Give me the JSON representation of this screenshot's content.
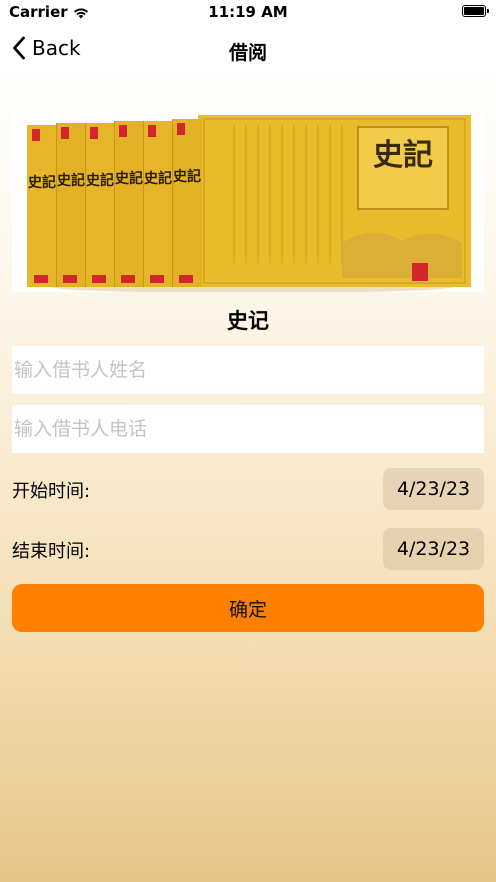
{
  "status_bar": {
    "carrier": "Carrier",
    "time": "11:19 AM"
  },
  "nav": {
    "back_label": "Back",
    "title": "借阅"
  },
  "book": {
    "title": "史记",
    "cover_spine_text": "史記",
    "cover_front_text": "史記"
  },
  "form": {
    "name_placeholder": "输入借书人姓名",
    "name_value": "",
    "phone_placeholder": "输入借书人电话",
    "phone_value": "",
    "start_label": "开始时间:",
    "start_date": "4/23/23",
    "end_label": "结束时间:",
    "end_date": "4/23/23",
    "confirm_label": "确定"
  },
  "colors": {
    "accent": "#ff8001",
    "cover_yellow": "#e9bc2c"
  },
  "icons": {
    "back": "chevron-left-icon",
    "wifi": "wifi-icon",
    "battery": "battery-icon"
  }
}
